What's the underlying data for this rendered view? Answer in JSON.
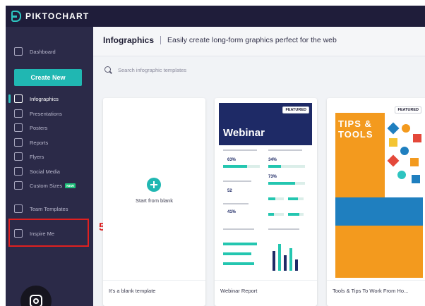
{
  "app": {
    "logo_text": "PIKTOCHART"
  },
  "sidebar": {
    "dashboard_label": "Dashboard",
    "create_button": "Create New",
    "items": [
      {
        "label": "Infographics",
        "icon": "chart-icon",
        "active": true
      },
      {
        "label": "Presentations",
        "icon": "presentation-icon"
      },
      {
        "label": "Posters",
        "icon": "poster-icon"
      },
      {
        "label": "Reports",
        "icon": "report-icon"
      },
      {
        "label": "Flyers",
        "icon": "flyer-icon"
      },
      {
        "label": "Social Media",
        "icon": "social-media-icon"
      },
      {
        "label": "Custom Sizes",
        "icon": "ruler-icon",
        "badge": "NEW"
      }
    ],
    "team_templates_label": "Team Templates",
    "inspire_me_label": "Inspire Me"
  },
  "annotation": {
    "step_number": "5",
    "color": "#e02020"
  },
  "header": {
    "title": "Infographics",
    "separator": "|",
    "subtitle": "Easily create long-form graphics perfect for the web"
  },
  "search": {
    "placeholder": "Search infographic templates"
  },
  "cards": [
    {
      "caption": "It's a blank template",
      "inner_label": "Start from blank"
    },
    {
      "caption": "Webinar Report",
      "badge": "FEATURED",
      "thumb_title": "Webinar"
    },
    {
      "caption": "Tools & Tips To Work From Ho...",
      "badge": "FEATURED",
      "thumb_title": "TIPS & TOOLS"
    }
  ],
  "webinar_thumb": {
    "stats": [
      "63%",
      "34%",
      "73%",
      "52",
      "41%"
    ]
  },
  "colors": {
    "topbar": "#1f1d3a",
    "sidebar": "#2b2a48",
    "accent": "#20b7b2",
    "highlight": "#e02020"
  }
}
